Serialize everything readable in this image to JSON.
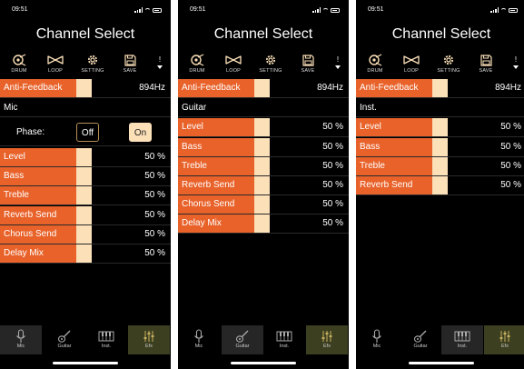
{
  "screens": [
    {
      "status": {
        "time": "09:51"
      },
      "title": "Channel Select",
      "toolbar": [
        {
          "icon": "drum-icon",
          "label": "DRUM"
        },
        {
          "icon": "loop-icon",
          "label": "LOOP"
        },
        {
          "icon": "gear-icon",
          "label": "SETTING"
        },
        {
          "icon": "save-icon",
          "label": "SAVE"
        }
      ],
      "anti_feedback": {
        "label": "Anti-Feedback",
        "value": "894Hz"
      },
      "section": "Mic",
      "phase": {
        "label": "Phase:",
        "off": "Off",
        "on": "On",
        "selected": "On"
      },
      "rows": [
        {
          "label": "Level",
          "value": "50 %"
        },
        {
          "label": "Bass",
          "value": "50 %"
        },
        {
          "label": "Treble",
          "value": "50 %"
        },
        {
          "label": "Reverb Send",
          "value": "50 %"
        },
        {
          "label": "Chorus Send",
          "value": "50 %"
        },
        {
          "label": "Delay Mix",
          "value": "50 %"
        }
      ],
      "tabs": [
        {
          "icon": "mic-icon",
          "label": "Mic"
        },
        {
          "icon": "guitar-icon",
          "label": "Guitar"
        },
        {
          "icon": "keyboard-icon",
          "label": "Inst."
        },
        {
          "icon": "efx-icon",
          "label": "Efx"
        }
      ],
      "selected_tab": "Mic"
    },
    {
      "status": {
        "time": "09:51"
      },
      "title": "Channel Select",
      "toolbar": [
        {
          "icon": "drum-icon",
          "label": "DRUM"
        },
        {
          "icon": "loop-icon",
          "label": "LOOP"
        },
        {
          "icon": "gear-icon",
          "label": "SETTING"
        },
        {
          "icon": "save-icon",
          "label": "SAVE"
        }
      ],
      "anti_feedback": {
        "label": "Anti-Feedback",
        "value": "894Hz"
      },
      "section": "Guitar",
      "rows": [
        {
          "label": "Level",
          "value": "50 %"
        },
        {
          "label": "Bass",
          "value": "50 %"
        },
        {
          "label": "Treble",
          "value": "50 %"
        },
        {
          "label": "Reverb Send",
          "value": "50 %"
        },
        {
          "label": "Chorus Send",
          "value": "50 %"
        },
        {
          "label": "Delay Mix",
          "value": "50 %"
        }
      ],
      "tabs": [
        {
          "icon": "mic-icon",
          "label": "Mic"
        },
        {
          "icon": "guitar-icon",
          "label": "Guitar"
        },
        {
          "icon": "keyboard-icon",
          "label": "Inst."
        },
        {
          "icon": "efx-icon",
          "label": "Efx"
        }
      ],
      "selected_tab": "Guitar"
    },
    {
      "status": {
        "time": "09:51"
      },
      "title": "Channel Select",
      "toolbar": [
        {
          "icon": "drum-icon",
          "label": "DRUM"
        },
        {
          "icon": "loop-icon",
          "label": "LOOP"
        },
        {
          "icon": "gear-icon",
          "label": "SETTING"
        },
        {
          "icon": "save-icon",
          "label": "SAVE"
        }
      ],
      "anti_feedback": {
        "label": "Anti-Feedback",
        "value": "894Hz"
      },
      "section": "Inst.",
      "rows": [
        {
          "label": "Level",
          "value": "50 %"
        },
        {
          "label": "Bass",
          "value": "50 %"
        },
        {
          "label": "Treble",
          "value": "50 %"
        },
        {
          "label": "Reverb Send",
          "value": "50 %"
        }
      ],
      "tabs": [
        {
          "icon": "mic-icon",
          "label": "Mic"
        },
        {
          "icon": "guitar-icon",
          "label": "Guitar"
        },
        {
          "icon": "keyboard-icon",
          "label": "Inst."
        },
        {
          "icon": "efx-icon",
          "label": "Efx"
        }
      ],
      "selected_tab": "Inst."
    }
  ],
  "colors": {
    "accent": "#e8622a",
    "swatch": "#fbe0b8",
    "background": "#000000",
    "efx_tab": "#3c3f20"
  }
}
